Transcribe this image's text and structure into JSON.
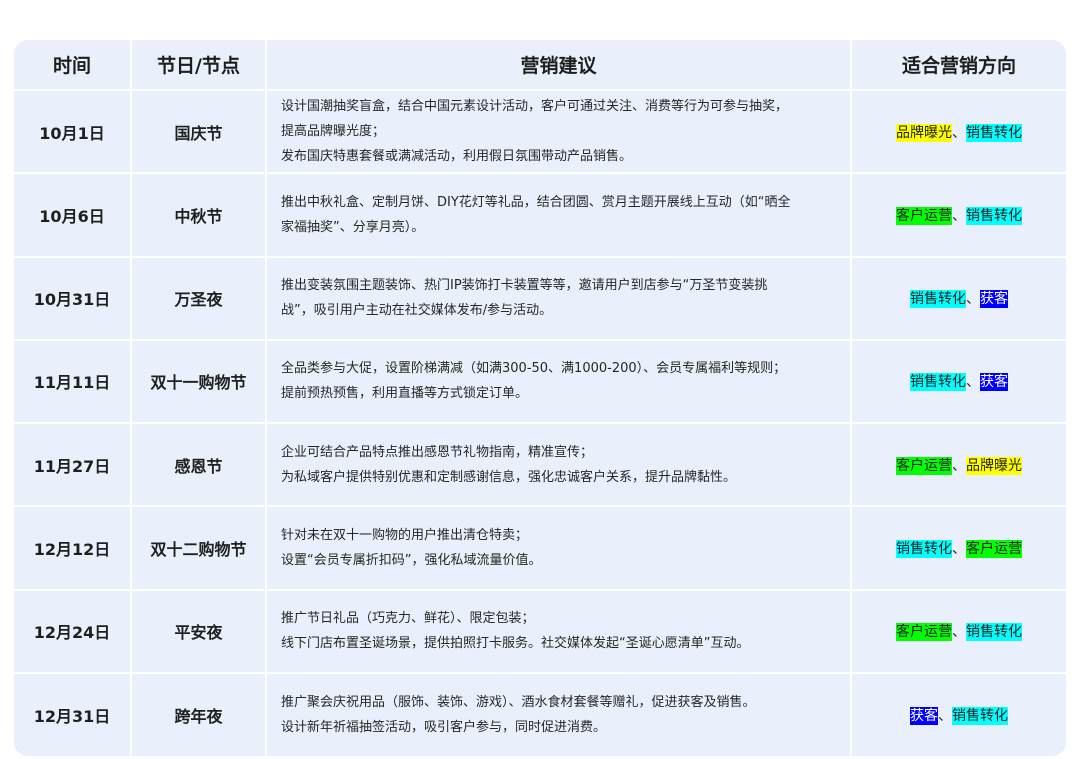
{
  "headers": [
    "时间",
    "节日/节点",
    "营销建议",
    "适合营销方向"
  ],
  "separator": "、",
  "rows": [
    {
      "date": "10月1日",
      "holiday": "国庆节",
      "advice": [
        "设计国潮抽奖盲盒，结合中国元素设计活动，客户可通过关注、消费等行为可参与抽奖，",
        "提高品牌曝光度；",
        "发布国庆特惠套餐或满减活动，利用假日氛围带动产品销售。"
      ],
      "directions": [
        {
          "label": "品牌曝光",
          "color": "#ffff00"
        },
        {
          "label": "销售转化",
          "color": "#00ffff"
        }
      ]
    },
    {
      "date": "10月6日",
      "holiday": "中秋节",
      "advice": [
        "推出中秋礼盒、定制月饼、DIY花灯等礼品，结合团圆、赏月主题开展线上互动（如“晒全",
        "家福抽奖”、分享月亮）。"
      ],
      "directions": [
        {
          "label": "客户运营",
          "color": "#00ff00"
        },
        {
          "label": "销售转化",
          "color": "#00ffff"
        }
      ]
    },
    {
      "date": "10月31日",
      "holiday": "万圣夜",
      "advice": [
        "推出变装氛围主题装饰、热门IP装饰打卡装置等等，邀请用户到店参与“万圣节变装挑",
        "战”，吸引用户主动在社交媒体发布/参与活动。"
      ],
      "directions": [
        {
          "label": "销售转化",
          "color": "#00ffff"
        },
        {
          "label": "获客",
          "color": "#0000ff"
        }
      ]
    },
    {
      "date": "11月11日",
      "holiday": "双十一购物节",
      "advice": [
        "全品类参与大促，设置阶梯满减（如满300-50、满1000-200）、会员专属福利等规则；",
        "提前预热预售，利用直播等方式锁定订单。"
      ],
      "directions": [
        {
          "label": "销售转化",
          "color": "#00ffff"
        },
        {
          "label": "获客",
          "color": "#0000ff"
        }
      ]
    },
    {
      "date": "11月27日",
      "holiday": "感恩节",
      "advice": [
        "企业可结合产品特点推出感恩节礼物指南，精准宣传；",
        "为私域客户提供特别优惠和定制感谢信息，强化忠诚客户关系，提升品牌黏性。"
      ],
      "directions": [
        {
          "label": "客户运营",
          "color": "#00ff00"
        },
        {
          "label": "品牌曝光",
          "color": "#ffff00"
        }
      ]
    },
    {
      "date": "12月12日",
      "holiday": "双十二购物节",
      "advice": [
        "针对未在双十一购物的用户推出清仓特卖；",
        "设置“会员专属折扣码”，强化私域流量价值。"
      ],
      "directions": [
        {
          "label": "销售转化",
          "color": "#00ffff"
        },
        {
          "label": "客户运营",
          "color": "#00ff00"
        }
      ]
    },
    {
      "date": "12月24日",
      "holiday": "平安夜",
      "advice": [
        "推广节日礼品（巧克力、鲜花）、限定包装；",
        "线下门店布置圣诞场景，提供拍照打卡服务。社交媒体发起“圣诞心愿清单”互动。"
      ],
      "directions": [
        {
          "label": "客户运营",
          "color": "#00ff00"
        },
        {
          "label": "销售转化",
          "color": "#00ffff"
        }
      ]
    },
    {
      "date": "12月31日",
      "holiday": "跨年夜",
      "advice": [
        "推广聚会庆祝用品（服饰、装饰、游戏）、酒水食材套餐等赠礼，促进获客及销售。",
        "设计新年祈福抽签活动，吸引客户参与，同时促进消费。"
      ],
      "directions": [
        {
          "label": "获客",
          "color": "#0000ff"
        },
        {
          "label": "销售转化",
          "color": "#00ffff"
        }
      ]
    }
  ]
}
